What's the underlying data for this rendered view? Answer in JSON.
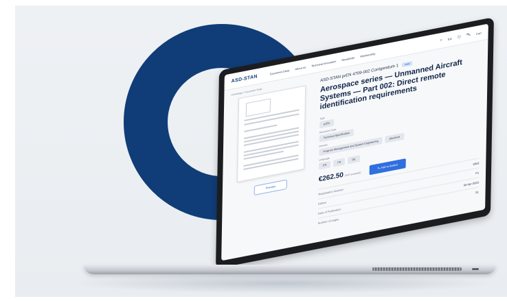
{
  "header": {
    "logo": "ASD-STAN",
    "nav": [
      "Document Shop",
      "About us",
      "Technical Innovation",
      "Newsletter",
      "Membership"
    ],
    "language": "EN",
    "cart_label": "Cart"
  },
  "breadcrumb": "Homepage  /  Document Shop",
  "document": {
    "code": "ASD-STAN prEN 4709-002 Corrigendum 1",
    "badge": "Valid",
    "title": "Aerospace series — Unmanned Aircraft Systems — Part 002: Direct remote identification requirements",
    "preview_label": "Preview",
    "fields": [
      {
        "label": "Type",
        "chips": [
          "prEN"
        ]
      },
      {
        "label": "Document Type",
        "chips": [
          "Technical Specification"
        ]
      },
      {
        "label": "Domain",
        "chips": [
          "Program Management and System Engineering",
          "Electrical"
        ]
      },
      {
        "label": "Language",
        "chips": [
          "EN",
          "FR",
          "DE"
        ]
      }
    ],
    "price": "€262.50",
    "price_note": "(VAT excluded)",
    "add_to_basket": "Add to basket",
    "meta": [
      {
        "label": "Registration Number",
        "value": "2843"
      },
      {
        "label": "Edition",
        "value": "P1"
      },
      {
        "label": "Date of Publication",
        "value": "30-Apr-2023"
      },
      {
        "label": "Number of pages",
        "value": "31"
      }
    ]
  },
  "colors": {
    "brand_navy": "#103d78",
    "accent_blue": "#2f6fdf"
  }
}
